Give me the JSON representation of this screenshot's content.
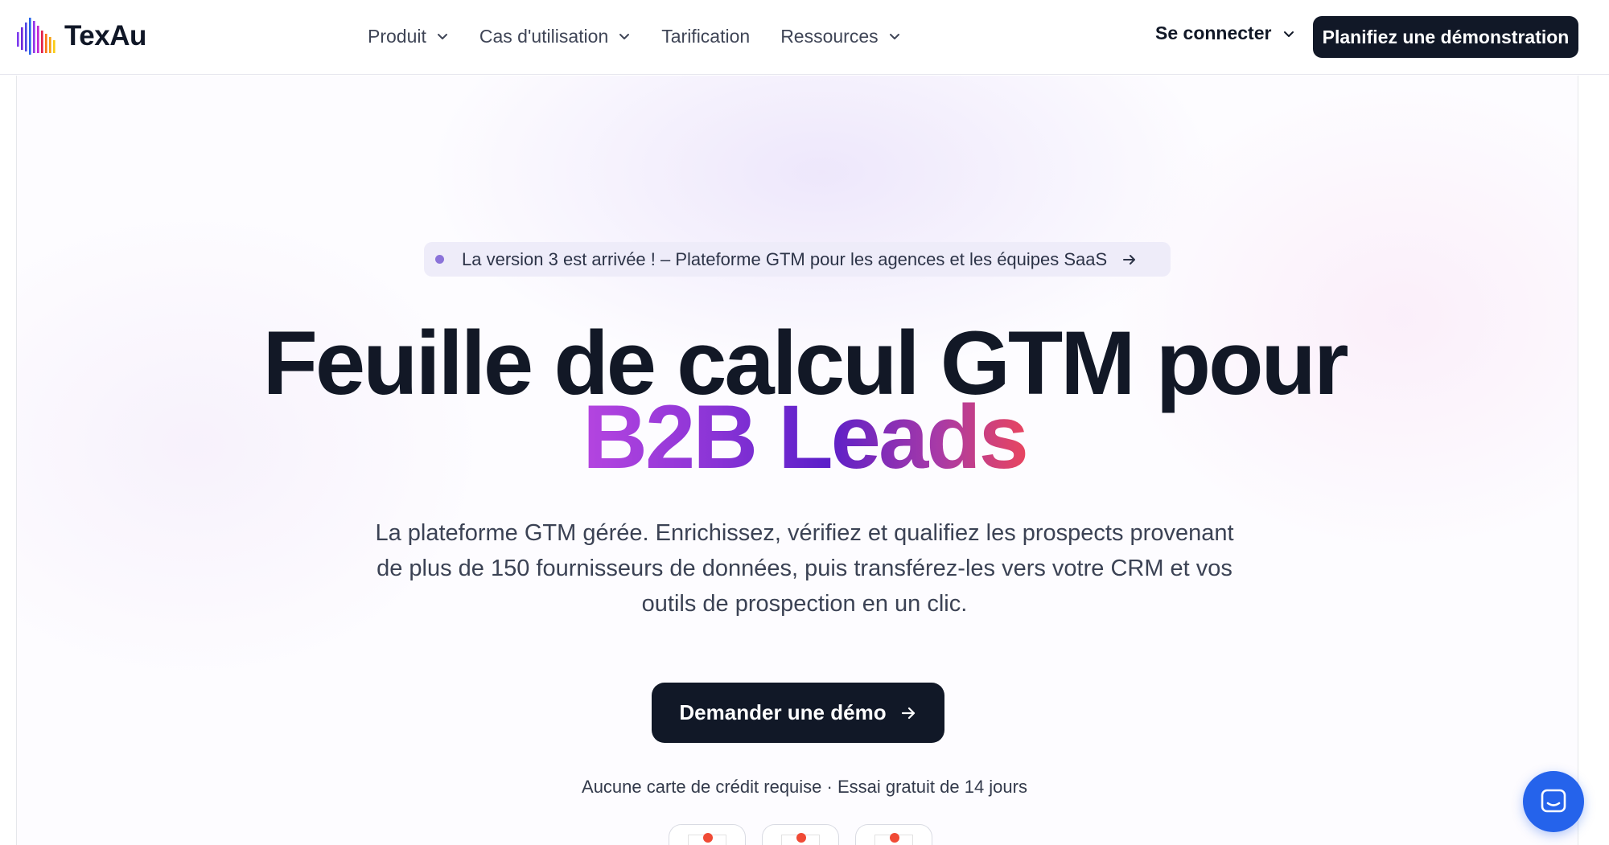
{
  "brand": {
    "name": "TexAu"
  },
  "nav": {
    "items": [
      {
        "label": "Produit",
        "has_dropdown": true
      },
      {
        "label": "Cas d'utilisation",
        "has_dropdown": true
      },
      {
        "label": "Tarification",
        "has_dropdown": false
      },
      {
        "label": "Ressources",
        "has_dropdown": true
      }
    ],
    "signin_label": "Se connecter",
    "cta_label": "Planifiez une démonstration"
  },
  "hero": {
    "announcement": "La version 3 est arrivée ! – Plateforme GTM pour les agences et les équipes SaaS",
    "title_line1": "Feuille de calcul GTM pour",
    "title_line2": "B2B Leads",
    "subtitle": "La plateforme GTM gérée. Enrichissez, vérifiez et qualifiez les prospects provenant de plus de 150 fournisseurs de données, puis transférez-les vers votre CRM et vos outils de prospection en un clic.",
    "cta_label": "Demander une démo",
    "note": "Aucune carte de crédit requise · Essai gratuit de 14 jours"
  },
  "colors": {
    "primary_dark": "#111827",
    "gradient": [
      "#b545e0",
      "#5b1fc9",
      "#e8455f"
    ],
    "chat_button": "#2563eb",
    "announcement_bg": "#eeecf9"
  },
  "icons": {
    "logo": "bars-logo-icon",
    "dropdown": "chevron-down-icon",
    "arrow": "arrow-right-icon",
    "chat": "chat-icon",
    "badge": "g2-badge-icon"
  }
}
